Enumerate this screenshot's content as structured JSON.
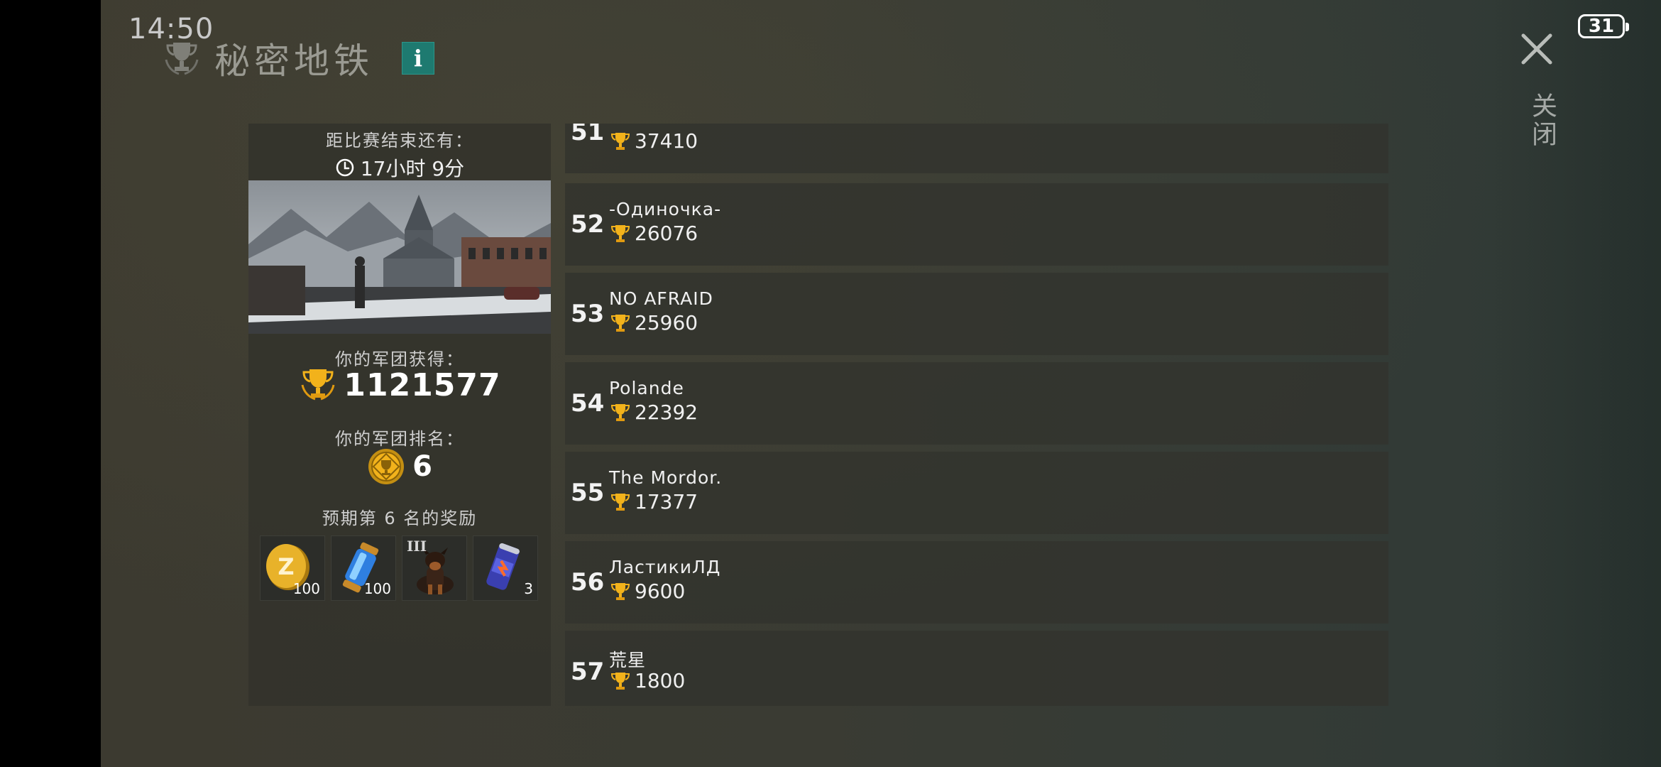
{
  "status_bar": {
    "time": "14:50",
    "battery": "31"
  },
  "header": {
    "title": "秘密地铁",
    "info_icon": "i",
    "close_label": "关闭"
  },
  "left_panel": {
    "countdown_label": "距比赛结束还有：",
    "countdown_value": "17小时 9分",
    "earned_label": "你的军团获得：",
    "earned_value": "1121577",
    "rank_label": "你的军团排名：",
    "rank_value": "6",
    "rewards_label": "预期第 6 名的奖励",
    "rewards": [
      {
        "icon": "gold-coin-icon",
        "count": "100",
        "tier": ""
      },
      {
        "icon": "energy-canister-icon",
        "count": "100",
        "tier": ""
      },
      {
        "icon": "dog-icon",
        "count": "",
        "tier": "III"
      },
      {
        "icon": "energy-drink-icon",
        "count": "3",
        "tier": ""
      }
    ]
  },
  "leaderboard": [
    {
      "rank": "51",
      "name": "",
      "score": "37410"
    },
    {
      "rank": "52",
      "name": "-Одиночка-",
      "score": "26076"
    },
    {
      "rank": "53",
      "name": "NO AFRAID",
      "score": "25960"
    },
    {
      "rank": "54",
      "name": "Polande",
      "score": "22392"
    },
    {
      "rank": "55",
      "name": "The Mordor.",
      "score": "17377"
    },
    {
      "rank": "56",
      "name": "ЛастикиЛД",
      "score": "9600"
    },
    {
      "rank": "57",
      "name": "荒星",
      "score": "1800"
    }
  ],
  "colors": {
    "accent_gold": "#f2b21b",
    "info_teal": "#1e7a70"
  }
}
